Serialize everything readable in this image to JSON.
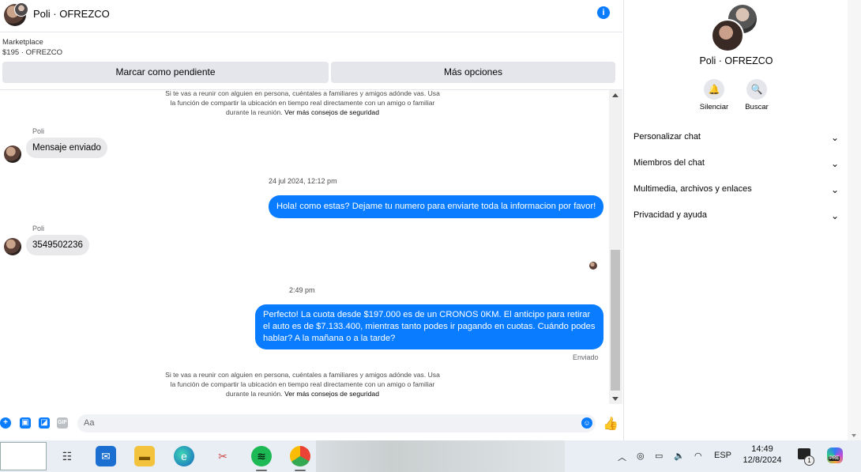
{
  "header": {
    "title": "Poli · OFREZCO"
  },
  "marketplace": {
    "label": "Marketplace",
    "listing": "$195 · OFREZCO"
  },
  "actions": {
    "pending": "Marcar como pendiente",
    "more": "Más opciones"
  },
  "safety_notice": {
    "text": "Si te vas a reunir con alguien en persona, cuéntales a familiares y amigos adónde vas. Usa la función de compartir la ubicación en tiempo real directamente con un amigo o familiar durante la reunión.",
    "link": "Ver más consejos de seguridad"
  },
  "messages": {
    "m1_sender": "Poli",
    "m1_text": "Mensaje enviado",
    "ts1": "24 jul 2024, 12:12 pm",
    "m2_text": "Hola! como estas? Dejame tu numero para enviarte toda la informacion por favor!",
    "m3_sender": "Poli",
    "m3_text": "3549502236",
    "ts2": "2:49 pm",
    "m4_text": "Perfecto! La cuota desde $197.000 es de un CRONOS 0KM. El anticipo para retirar el auto es de $7.133.400, mientras tanto podes ir pagando en cuotas. Cuándo podes hablar? A la mañana o a la tarde?",
    "m4_status": "Enviado"
  },
  "composer": {
    "placeholder": "Aa"
  },
  "sidebar": {
    "name": "Poli · OFREZCO",
    "mute_label": "Silenciar",
    "search_label": "Buscar",
    "items": [
      {
        "label": "Personalizar chat"
      },
      {
        "label": "Miembros del chat"
      },
      {
        "label": "Multimedia, archivos y enlaces"
      },
      {
        "label": "Privacidad y ayuda"
      }
    ]
  },
  "taskbar": {
    "language": "ESP",
    "time": "14:49",
    "date": "12/8/2024",
    "notification_count": "1",
    "copilot_badge": "PRE"
  },
  "colors": {
    "accent": "#0a7cff",
    "incoming_bubble": "#e9e9eb"
  }
}
